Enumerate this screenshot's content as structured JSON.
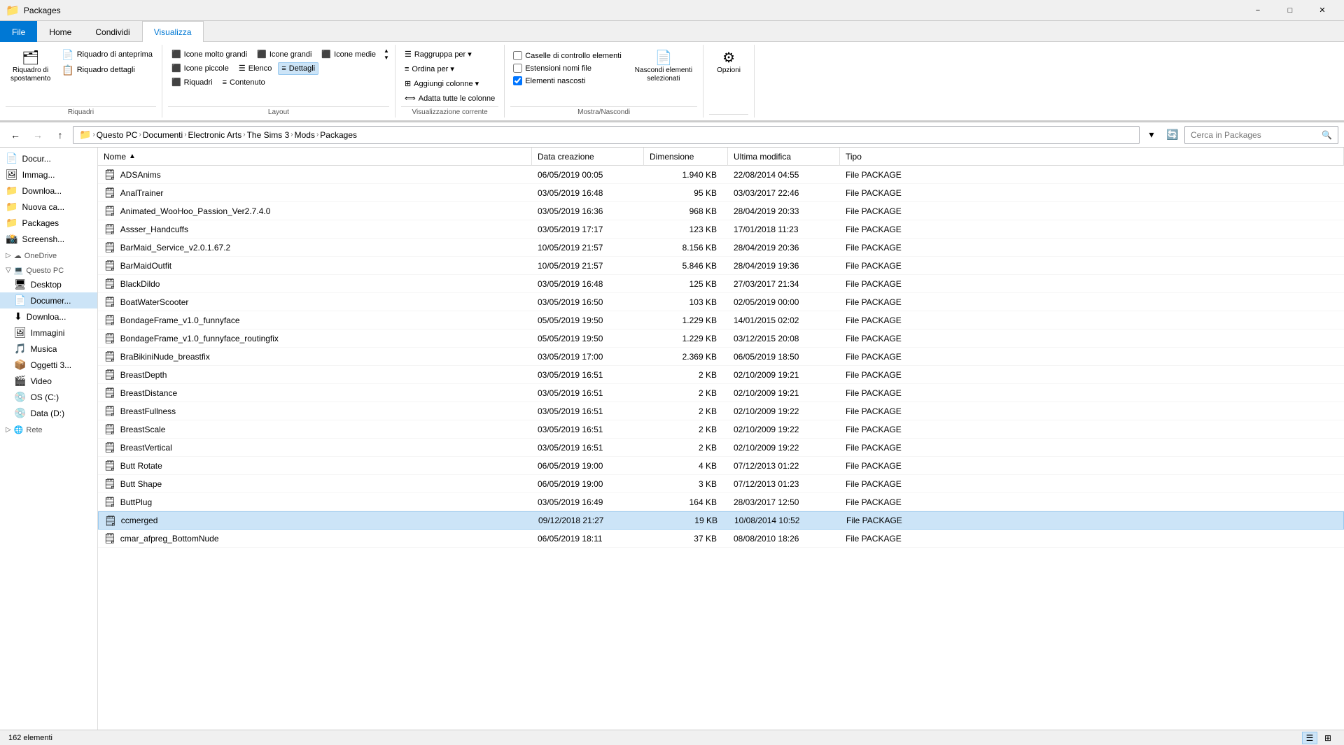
{
  "titleBar": {
    "title": "Packages",
    "minimizeLabel": "−",
    "maximizeLabel": "□",
    "closeLabel": "✕"
  },
  "ribbon": {
    "tabs": [
      "File",
      "Home",
      "Condividi",
      "Visualizza"
    ],
    "activeTab": "Visualizza",
    "groups": {
      "riquadri": {
        "label": "Riquadri",
        "buttons": [
          {
            "icon": "🗂",
            "label": "Riquadro di\nspostamento"
          },
          {
            "icon": "👁",
            "label": "Riquadro di anteprima"
          },
          {
            "icon": "📋",
            "label": "Riquadro dettagli"
          }
        ]
      },
      "layout": {
        "label": "Layout",
        "views": [
          "Icone molto grandi",
          "Icone grandi",
          "Icone medie",
          "Icone piccole",
          "Elenco",
          "Dettagli",
          "Riquadri",
          "Contenuto",
          ""
        ],
        "selectedView": "Dettagli"
      },
      "visualizzazioneCorrente": {
        "label": "Visualizzazione corrente",
        "buttons": [
          {
            "icon": "≡",
            "label": "Ordina per▾"
          },
          {
            "icon": "⊞",
            "label": "Aggiungi colonne▾"
          },
          {
            "icon": "⟺",
            "label": "Adatta tutte le colonne"
          }
        ],
        "raggruppaPer": "Raggruppa per▾"
      },
      "mostraNascondi": {
        "label": "Mostra/Nascondi",
        "checkboxes": [
          {
            "label": "Caselle di controllo elementi",
            "checked": false
          },
          {
            "label": "Estensioni nomi file",
            "checked": false
          },
          {
            "label": "Elementi nascosti",
            "checked": true
          }
        ],
        "buttons": [
          {
            "icon": "👁",
            "label": "Nascondi elementi\nselezionati"
          }
        ]
      },
      "opzioni": {
        "label": "",
        "buttons": [
          {
            "icon": "⚙",
            "label": "Opzioni"
          }
        ]
      }
    }
  },
  "addressBar": {
    "backDisabled": false,
    "forwardDisabled": true,
    "upDisabled": false,
    "path": [
      "Questo PC",
      "Documenti",
      "Electronic Arts",
      "The Sims 3",
      "Mods",
      "Packages"
    ],
    "searchPlaceholder": "Cerca in Packages"
  },
  "sidebar": {
    "items": [
      {
        "type": "item",
        "icon": "📄",
        "label": "Docur...",
        "selected": false
      },
      {
        "type": "item",
        "icon": "🖼",
        "label": "Immag...",
        "selected": false
      },
      {
        "type": "item",
        "icon": "📁",
        "label": "Downloa...",
        "selected": false
      },
      {
        "type": "item",
        "icon": "📁",
        "label": "Nuova ca...",
        "selected": false
      },
      {
        "type": "item",
        "icon": "📁",
        "label": "Packages",
        "selected": false
      },
      {
        "type": "item",
        "icon": "📸",
        "label": "Screensh...",
        "selected": false
      },
      {
        "type": "section",
        "icon": "☁",
        "label": "OneDrive",
        "expanded": true
      },
      {
        "type": "section",
        "icon": "💻",
        "label": "Questo PC",
        "expanded": true
      },
      {
        "type": "item",
        "icon": "🖥",
        "label": "Desktop",
        "selected": false
      },
      {
        "type": "item",
        "icon": "📄",
        "label": "Documer...",
        "selected": true
      },
      {
        "type": "item",
        "icon": "⬇",
        "label": "Downloa...",
        "selected": false
      },
      {
        "type": "item",
        "icon": "🖼",
        "label": "Immagini",
        "selected": false
      },
      {
        "type": "item",
        "icon": "🎵",
        "label": "Musica",
        "selected": false
      },
      {
        "type": "item",
        "icon": "📦",
        "label": "Oggetti 3...",
        "selected": false
      },
      {
        "type": "item",
        "icon": "🎬",
        "label": "Video",
        "selected": false
      },
      {
        "type": "item",
        "icon": "💿",
        "label": "OS (C:)",
        "selected": false
      },
      {
        "type": "item",
        "icon": "💿",
        "label": "Data (D:)",
        "selected": false
      },
      {
        "type": "section",
        "icon": "🌐",
        "label": "Rete",
        "expanded": false
      }
    ]
  },
  "fileList": {
    "columns": [
      "Nome",
      "Data creazione",
      "Dimensione",
      "Ultima modifica",
      "Tipo"
    ],
    "rows": [
      {
        "name": "ADSAnims",
        "created": "06/05/2019 00:05",
        "size": "1.940 KB",
        "modified": "22/08/2014 04:55",
        "type": "File PACKAGE",
        "selected": false
      },
      {
        "name": "AnalTrainer",
        "created": "03/05/2019 16:48",
        "size": "95 KB",
        "modified": "03/03/2017 22:46",
        "type": "File PACKAGE",
        "selected": false
      },
      {
        "name": "Animated_WooHoo_Passion_Ver2.7.4.0",
        "created": "03/05/2019 16:36",
        "size": "968 KB",
        "modified": "28/04/2019 20:33",
        "type": "File PACKAGE",
        "selected": false
      },
      {
        "name": "Assser_Handcuffs",
        "created": "03/05/2019 17:17",
        "size": "123 KB",
        "modified": "17/01/2018 11:23",
        "type": "File PACKAGE",
        "selected": false
      },
      {
        "name": "BarMaid_Service_v2.0.1.67.2",
        "created": "10/05/2019 21:57",
        "size": "8.156 KB",
        "modified": "28/04/2019 20:36",
        "type": "File PACKAGE",
        "selected": false
      },
      {
        "name": "BarMaidOutfit",
        "created": "10/05/2019 21:57",
        "size": "5.846 KB",
        "modified": "28/04/2019 19:36",
        "type": "File PACKAGE",
        "selected": false
      },
      {
        "name": "BlackDildo",
        "created": "03/05/2019 16:48",
        "size": "125 KB",
        "modified": "27/03/2017 21:34",
        "type": "File PACKAGE",
        "selected": false
      },
      {
        "name": "BoatWaterScooter",
        "created": "03/05/2019 16:50",
        "size": "103 KB",
        "modified": "02/05/2019 00:00",
        "type": "File PACKAGE",
        "selected": false
      },
      {
        "name": "BondageFrame_v1.0_funnyface",
        "created": "05/05/2019 19:50",
        "size": "1.229 KB",
        "modified": "14/01/2015 02:02",
        "type": "File PACKAGE",
        "selected": false
      },
      {
        "name": "BondageFrame_v1.0_funnyface_routingfix",
        "created": "05/05/2019 19:50",
        "size": "1.229 KB",
        "modified": "03/12/2015 20:08",
        "type": "File PACKAGE",
        "selected": false
      },
      {
        "name": "BraBikiniNude_breastfix",
        "created": "03/05/2019 17:00",
        "size": "2.369 KB",
        "modified": "06/05/2019 18:50",
        "type": "File PACKAGE",
        "selected": false
      },
      {
        "name": "BreastDepth",
        "created": "03/05/2019 16:51",
        "size": "2 KB",
        "modified": "02/10/2009 19:21",
        "type": "File PACKAGE",
        "selected": false
      },
      {
        "name": "BreastDistance",
        "created": "03/05/2019 16:51",
        "size": "2 KB",
        "modified": "02/10/2009 19:21",
        "type": "File PACKAGE",
        "selected": false
      },
      {
        "name": "BreastFullness",
        "created": "03/05/2019 16:51",
        "size": "2 KB",
        "modified": "02/10/2009 19:22",
        "type": "File PACKAGE",
        "selected": false
      },
      {
        "name": "BreastScale",
        "created": "03/05/2019 16:51",
        "size": "2 KB",
        "modified": "02/10/2009 19:22",
        "type": "File PACKAGE",
        "selected": false
      },
      {
        "name": "BreastVertical",
        "created": "03/05/2019 16:51",
        "size": "2 KB",
        "modified": "02/10/2009 19:22",
        "type": "File PACKAGE",
        "selected": false
      },
      {
        "name": "Butt Rotate",
        "created": "06/05/2019 19:00",
        "size": "4 KB",
        "modified": "07/12/2013 01:22",
        "type": "File PACKAGE",
        "selected": false
      },
      {
        "name": "Butt Shape",
        "created": "06/05/2019 19:00",
        "size": "3 KB",
        "modified": "07/12/2013 01:23",
        "type": "File PACKAGE",
        "selected": false
      },
      {
        "name": "ButtPlug",
        "created": "03/05/2019 16:49",
        "size": "164 KB",
        "modified": "28/03/2017 12:50",
        "type": "File PACKAGE",
        "selected": false
      },
      {
        "name": "ccmerged",
        "created": "09/12/2018 21:27",
        "size": "19 KB",
        "modified": "10/08/2014 10:52",
        "type": "File PACKAGE",
        "selected": true
      },
      {
        "name": "cmar_afpreg_BottomNude",
        "created": "06/05/2019 18:11",
        "size": "37 KB",
        "modified": "08/08/2010 18:26",
        "type": "File PACKAGE",
        "selected": false
      }
    ]
  },
  "statusBar": {
    "itemCount": "162 elementi",
    "viewMode": "details"
  }
}
